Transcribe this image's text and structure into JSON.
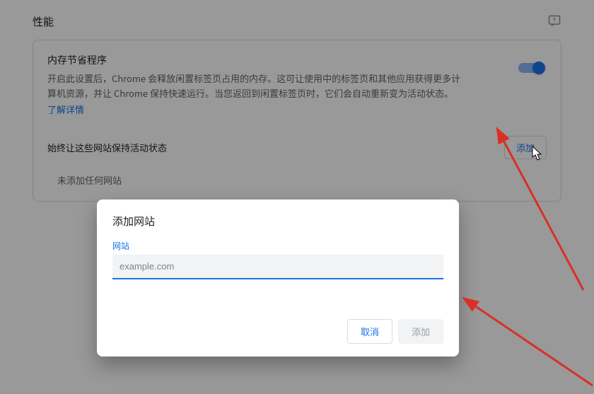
{
  "page": {
    "title": "性能",
    "card": {
      "memSaverTitle": "内存节省程序",
      "memSaverDesc": "开启此设置后，Chrome 会释放闲置标签页占用的内存。这可让使用中的标签页和其他应用获得更多计算机资源，并让 Chrome 保持快速运行。当您返回到闲置标签页时，它们会自动重新变为活动状态。",
      "learnMore": "了解详情",
      "alwaysActiveLabel": "始终让这些网站保持活动状态",
      "addButton": "添加",
      "noneText": "未添加任何网站"
    }
  },
  "dialog": {
    "title": "添加网站",
    "fieldLabel": "网站",
    "placeholder": "example.com",
    "value": "",
    "cancel": "取消",
    "add": "添加"
  },
  "colors": {
    "accent": "#1a73e8"
  }
}
